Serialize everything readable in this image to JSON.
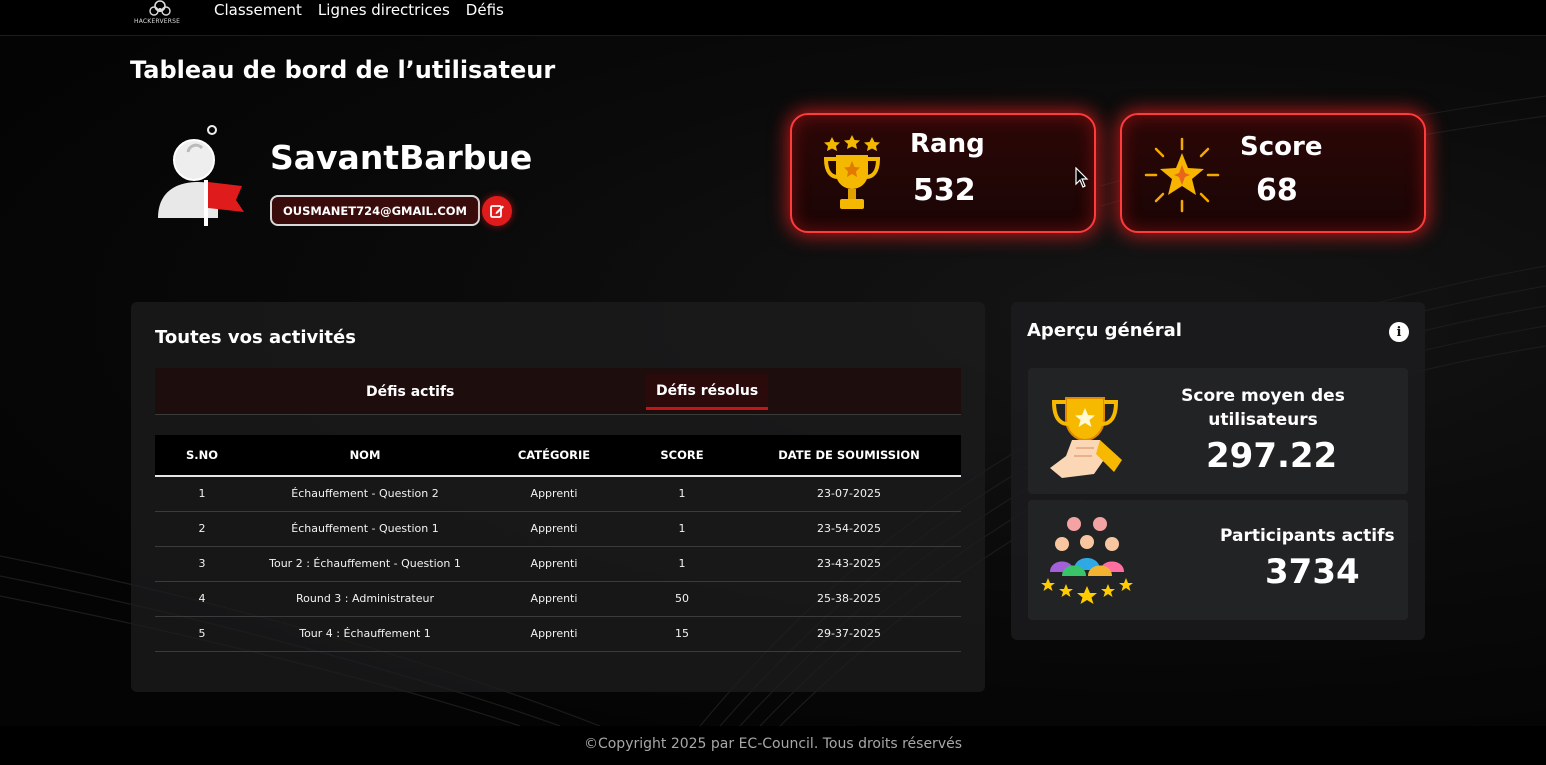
{
  "nav": {
    "logo_text": "HACKERVERSE",
    "items": [
      "Classement",
      "Lignes directrices",
      "Défis"
    ]
  },
  "page_title": "Tableau de bord de l’utilisateur",
  "profile": {
    "username": "SavantBarbue",
    "email": "OUSMANET724@GMAIL.COM"
  },
  "stats": {
    "rank_label": "Rang",
    "rank_value": "532",
    "score_label": "Score",
    "score_value": "68"
  },
  "activities": {
    "title": "Toutes vos activités",
    "tabs": [
      {
        "label": "Défis actifs",
        "active": false
      },
      {
        "label": "Défis résolus",
        "active": true
      }
    ],
    "columns": [
      "S.NO",
      "NOM",
      "CATÉGORIE",
      "SCORE",
      "DATE DE SOUMISSION"
    ],
    "rows": [
      [
        "1",
        "Échauffement - Question 2",
        "Apprenti",
        "1",
        "23-07-2025"
      ],
      [
        "2",
        "Échauffement - Question 1",
        "Apprenti",
        "1",
        "23-54-2025"
      ],
      [
        "3",
        "Tour 2 : Échauffement - Question 1",
        "Apprenti",
        "1",
        "23-43-2025"
      ],
      [
        "4",
        "Round 3 : Administrateur",
        "Apprenti",
        "50",
        "25-38-2025"
      ],
      [
        "5",
        "Tour 4 : Échauffement 1",
        "Apprenti",
        "15",
        "29-37-2025"
      ]
    ]
  },
  "overview": {
    "title": "Aperçu général",
    "avg_label": "Score moyen des utilisateurs",
    "avg_value": "297.22",
    "participants_label": "Participants actifs",
    "participants_value": "3734"
  },
  "footer": "©Copyright 2025 par EC-Council. Tous droits réservés",
  "colors": {
    "accent_red": "#e01b1b",
    "glow_red": "#ff3b3b",
    "background": "#000000"
  }
}
